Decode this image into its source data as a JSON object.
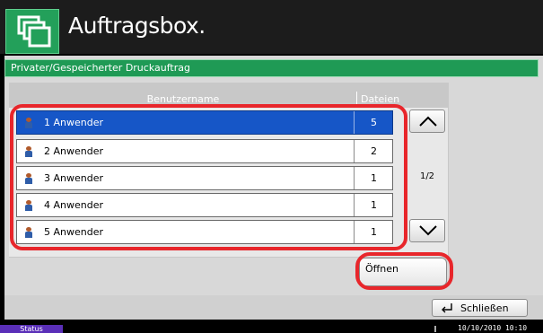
{
  "header": {
    "title": "Auftragsbox.",
    "icon": "document-box-icon"
  },
  "panel": {
    "title": "Privater/Gespeicherter Druckauftrag"
  },
  "table": {
    "columns": {
      "user": "Benutzername",
      "files": "Dateien"
    },
    "rows": [
      {
        "name": "1 Anwender",
        "count": "5",
        "selected": true
      },
      {
        "name": "2 Anwender",
        "count": "2",
        "selected": false
      },
      {
        "name": "3 Anwender",
        "count": "1",
        "selected": false
      },
      {
        "name": "4 Anwender",
        "count": "1",
        "selected": false
      },
      {
        "name": "5 Anwender",
        "count": "1",
        "selected": false
      }
    ]
  },
  "pagination": {
    "indicator": "1/2"
  },
  "actions": {
    "open_label": "Öffnen",
    "close_label": "Schließen"
  },
  "statusbar": {
    "status_label": "Status",
    "datetime": "10/10/2010 10:10"
  },
  "colors": {
    "header_green": "#23a05a",
    "selection_blue": "#1656c7",
    "highlight_red": "#e8262b"
  }
}
